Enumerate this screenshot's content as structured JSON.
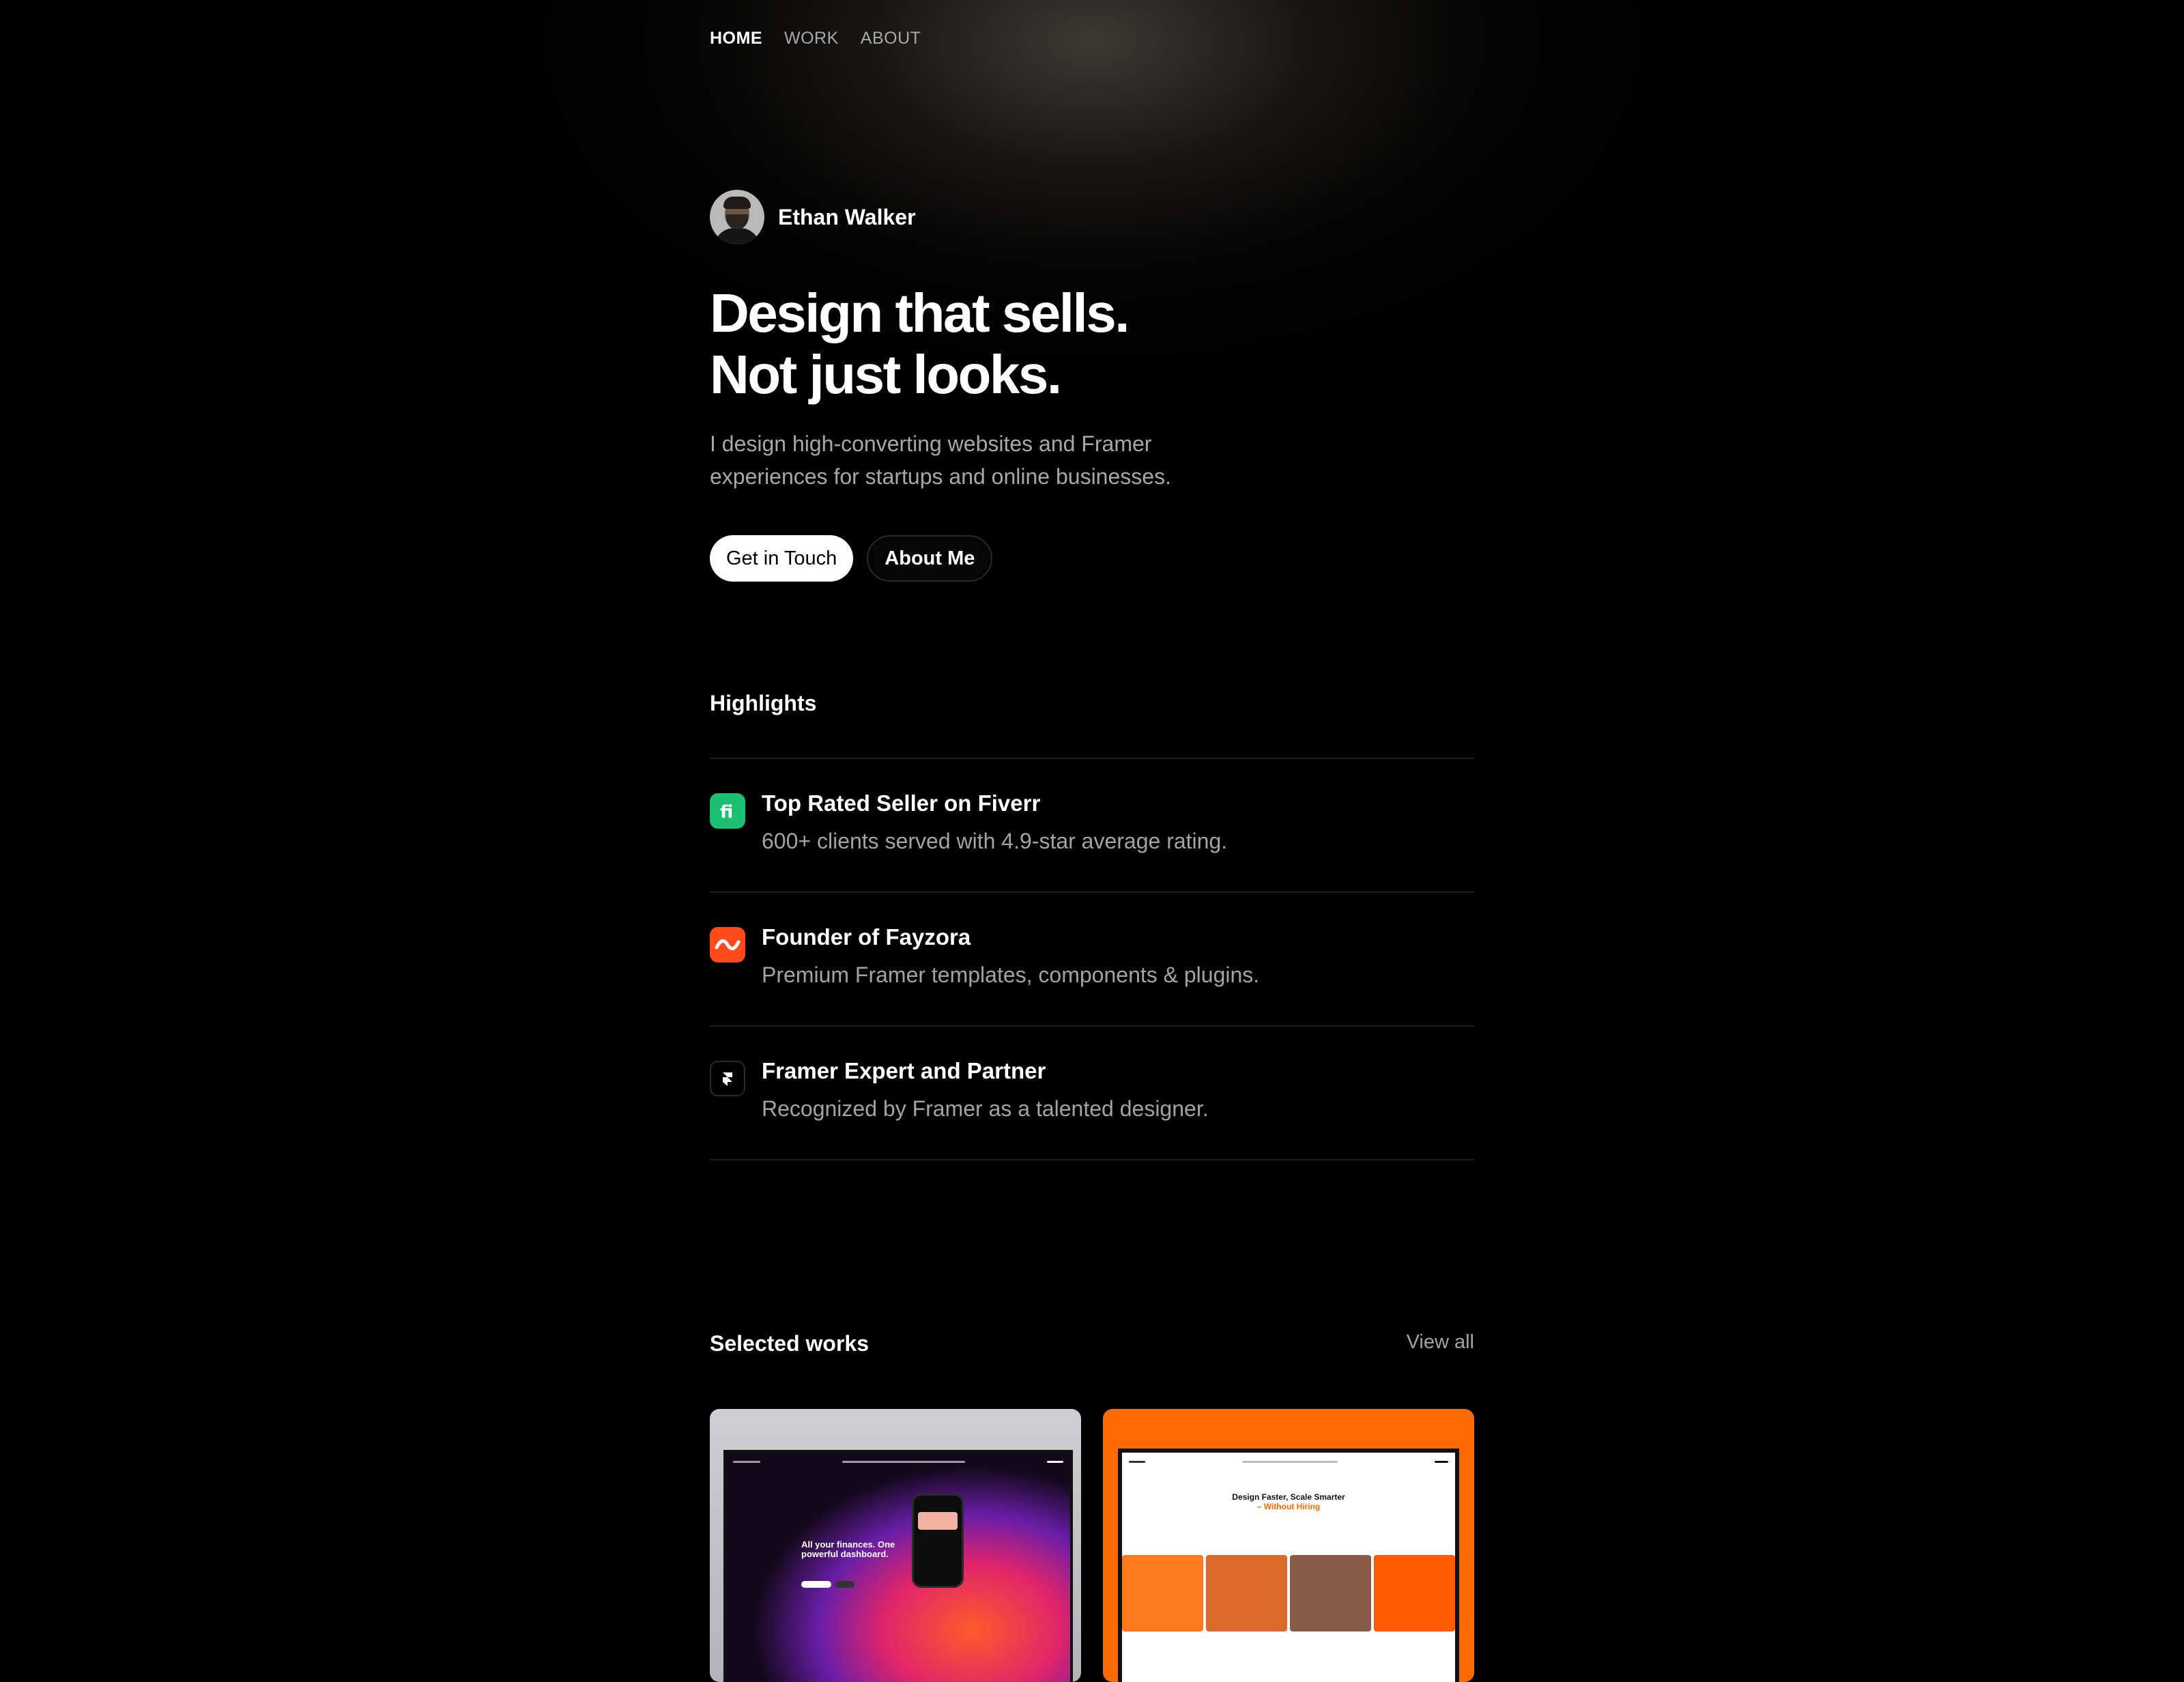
{
  "nav": {
    "home": "HOME",
    "work": "WORK",
    "about": "ABOUT"
  },
  "profile": {
    "name": "Ethan Walker"
  },
  "hero": {
    "title_line1": "Design that sells.",
    "title_line2": "Not just looks.",
    "subtitle": "I design high-converting websites and Framer experiences for startups and online businesses.",
    "primary_button": "Get in Touch",
    "secondary_button": "About Me"
  },
  "highlights": {
    "title": "Highlights",
    "items": [
      {
        "icon": "fiverr-icon",
        "color": "#1dbf73",
        "title": "Top Rated Seller on Fiverr",
        "desc": "600+ clients served with 4.9-star average rating."
      },
      {
        "icon": "fayzora-icon",
        "color": "#ff4a1c",
        "title": "Founder of Fayzora",
        "desc": "Premium Framer templates, components & plugins."
      },
      {
        "icon": "framer-icon",
        "color": "#000000",
        "title": "Framer Expert and Partner",
        "desc": "Recognized by Framer as a talented designer."
      }
    ]
  },
  "works": {
    "title": "Selected works",
    "view_all": "View all",
    "cards": [
      {
        "hero_text": "All your finances. One powerful dashboard."
      },
      {
        "hero_text": "Design Faster, Scale Smarter",
        "hero_accent": "– Without Hiring"
      }
    ]
  }
}
